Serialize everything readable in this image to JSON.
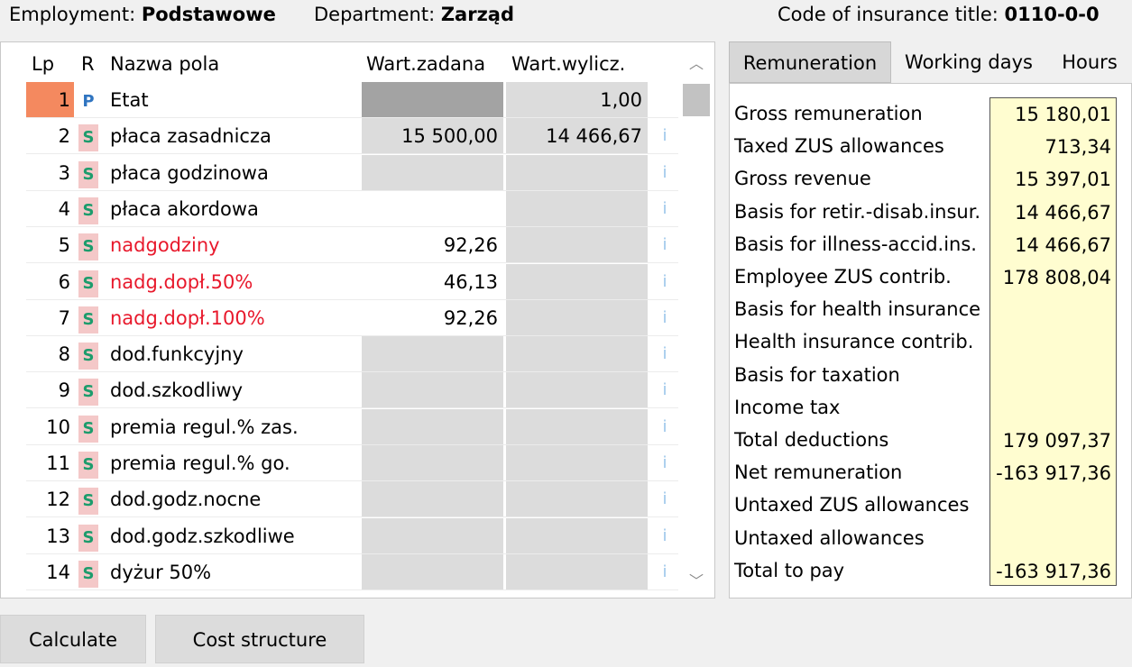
{
  "header": {
    "employment_label": "Employment: ",
    "employment_value": "Podstawowe",
    "department_label": "Department: ",
    "department_value": "Zarząd",
    "insurance_label": "Code of insurance title: ",
    "insurance_value": "0110-0-0"
  },
  "grid": {
    "columns": {
      "lp": "Lp",
      "r": "R",
      "name": "Nazwa pola",
      "wz": "Wart.zadana",
      "ww": "Wart.wylicz."
    },
    "info_glyph": "i",
    "rows": [
      {
        "lp": "1",
        "r": "P",
        "name": "Etat",
        "wz": "",
        "ww": "1,00",
        "red": false
      },
      {
        "lp": "2",
        "r": "S",
        "name": "płaca zasadnicza",
        "wz": "15 500,00",
        "ww": "14 466,67",
        "red": false
      },
      {
        "lp": "3",
        "r": "S",
        "name": "płaca godzinowa",
        "wz": "",
        "ww": "",
        "red": false
      },
      {
        "lp": "4",
        "r": "S",
        "name": "płaca akordowa",
        "wz": "",
        "ww": "",
        "red": false
      },
      {
        "lp": "5",
        "r": "S",
        "name": "nadgodziny",
        "wz": "92,26",
        "ww": "",
        "red": true
      },
      {
        "lp": "6",
        "r": "S",
        "name": "nadg.dopł.50%",
        "wz": "46,13",
        "ww": "",
        "red": true
      },
      {
        "lp": "7",
        "r": "S",
        "name": "nadg.dopł.100%",
        "wz": "92,26",
        "ww": "",
        "red": true
      },
      {
        "lp": "8",
        "r": "S",
        "name": "dod.funkcyjny",
        "wz": "",
        "ww": "",
        "red": false
      },
      {
        "lp": "9",
        "r": "S",
        "name": "dod.szkodliwy",
        "wz": "",
        "ww": "",
        "red": false
      },
      {
        "lp": "10",
        "r": "S",
        "name": "premia regul.% zas.",
        "wz": "",
        "ww": "",
        "red": false
      },
      {
        "lp": "11",
        "r": "S",
        "name": "premia regul.% go.",
        "wz": "",
        "ww": "",
        "red": false
      },
      {
        "lp": "12",
        "r": "S",
        "name": "dod.godz.nocne",
        "wz": "",
        "ww": "",
        "red": false
      },
      {
        "lp": "13",
        "r": "S",
        "name": "dod.godz.szkodliwe",
        "wz": "",
        "ww": "",
        "red": false
      },
      {
        "lp": "14",
        "r": "S",
        "name": "dyżur 50%",
        "wz": "",
        "ww": "",
        "red": false
      }
    ]
  },
  "tabs": [
    "Remuneration",
    "Working days",
    "Hours"
  ],
  "summary": [
    {
      "label": "Gross remuneration",
      "value": "15 180,01"
    },
    {
      "label": "Taxed ZUS allowances",
      "value": "713,34"
    },
    {
      "label": "Gross revenue",
      "value": "15 397,01"
    },
    {
      "label": "Basis for retir.-disab.insur.",
      "value": "14 466,67"
    },
    {
      "label": "Basis for illness-accid.ins.",
      "value": "14 466,67"
    },
    {
      "label": "Employee ZUS contrib.",
      "value": "178 808,04"
    },
    {
      "label": "Basis for health insurance",
      "value": ""
    },
    {
      "label": "Health insurance contrib.",
      "value": ""
    },
    {
      "label": "Basis for taxation",
      "value": ""
    },
    {
      "label": "Income tax",
      "value": ""
    },
    {
      "label": "Total deductions",
      "value": "179 097,37"
    },
    {
      "label": "Net remuneration",
      "value": "-163 917,36"
    },
    {
      "label": "Untaxed ZUS allowances",
      "value": ""
    },
    {
      "label": "Untaxed allowances",
      "value": ""
    },
    {
      "label": "Total to pay",
      "value": "-163 917,36"
    }
  ],
  "buttons": {
    "calculate": "Calculate",
    "cost_structure": "Cost structure"
  }
}
